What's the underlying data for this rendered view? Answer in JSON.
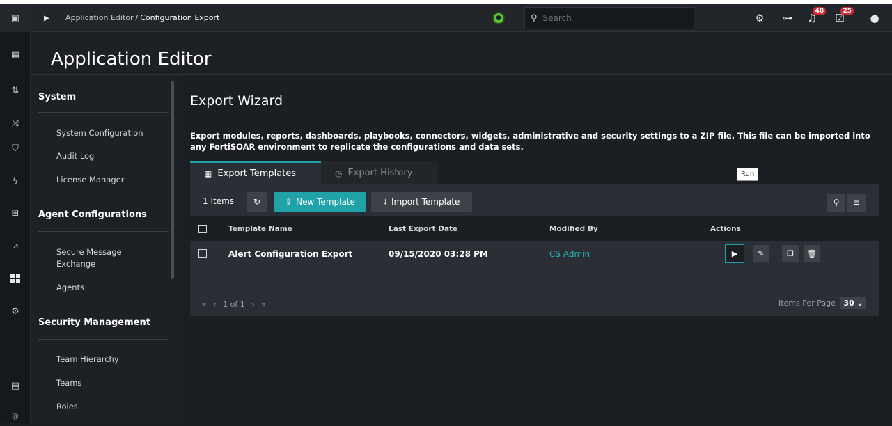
{
  "rail": {
    "items": [
      {
        "icon": "app-logo-icon",
        "glyph": "▣"
      },
      {
        "icon": "dashboard-icon",
        "glyph": "▦"
      },
      {
        "icon": "sort-icon",
        "glyph": "⇅"
      },
      {
        "icon": "shuffle-icon",
        "glyph": "⤨"
      },
      {
        "icon": "shield-icon",
        "glyph": "⛉"
      },
      {
        "icon": "lightning-icon",
        "glyph": "ϟ"
      },
      {
        "icon": "briefcase-icon",
        "glyph": "⊞"
      },
      {
        "icon": "chart-icon",
        "glyph": "⩘"
      },
      {
        "icon": "grid-active-icon",
        "glyph": "▪"
      },
      {
        "icon": "settings-gear-icon",
        "glyph": "⚙"
      },
      {
        "icon": "clipboard-icon",
        "glyph": "▤"
      },
      {
        "icon": "at-icon",
        "glyph": "@"
      }
    ]
  },
  "topbar": {
    "breadcrumb_parent": "Application Editor",
    "breadcrumb_sep": "/",
    "breadcrumb_current": "Configuration Export",
    "search_placeholder": "Search",
    "notifications_count": "48",
    "tasks_count": "25"
  },
  "page": {
    "title": "Application Editor"
  },
  "sidenav": {
    "sections": [
      {
        "title": "System",
        "items": [
          "System Configuration",
          "Audit Log",
          "License Manager"
        ]
      },
      {
        "title": "Agent Configurations",
        "items": [
          "Secure Message Exchange",
          "Agents"
        ]
      },
      {
        "title": "Security Management",
        "items": [
          "Team Hierarchy",
          "Teams",
          "Roles"
        ]
      }
    ]
  },
  "wizard": {
    "title": "Export Wizard",
    "description": "Export modules, reports, dashboards, playbooks, connectors, widgets, administrative and security settings to a ZIP file. This file can be imported into any FortiSOAR environment to replicate the configurations and data sets.",
    "tabs": [
      {
        "label": "Export Templates",
        "active": true
      },
      {
        "label": "Export History",
        "active": false
      }
    ]
  },
  "toolbar": {
    "count": "1 Items",
    "new_label": "New Template",
    "import_label": "Import Template"
  },
  "table": {
    "columns": [
      "Template Name",
      "Last Export Date",
      "Modified By",
      "Actions"
    ],
    "rows": [
      {
        "name": "Alert Configuration Export",
        "date": "09/15/2020 03:28 PM",
        "modified_by": "CS Admin"
      }
    ],
    "tooltip": "Run"
  },
  "pagination": {
    "page_info": "1 of 1",
    "items_per_page_label": "Items Per Page",
    "items_per_page": "30"
  },
  "colors": {
    "accent": "#1fa3a8",
    "badge": "#d6262f",
    "status": "#5cc33b"
  }
}
